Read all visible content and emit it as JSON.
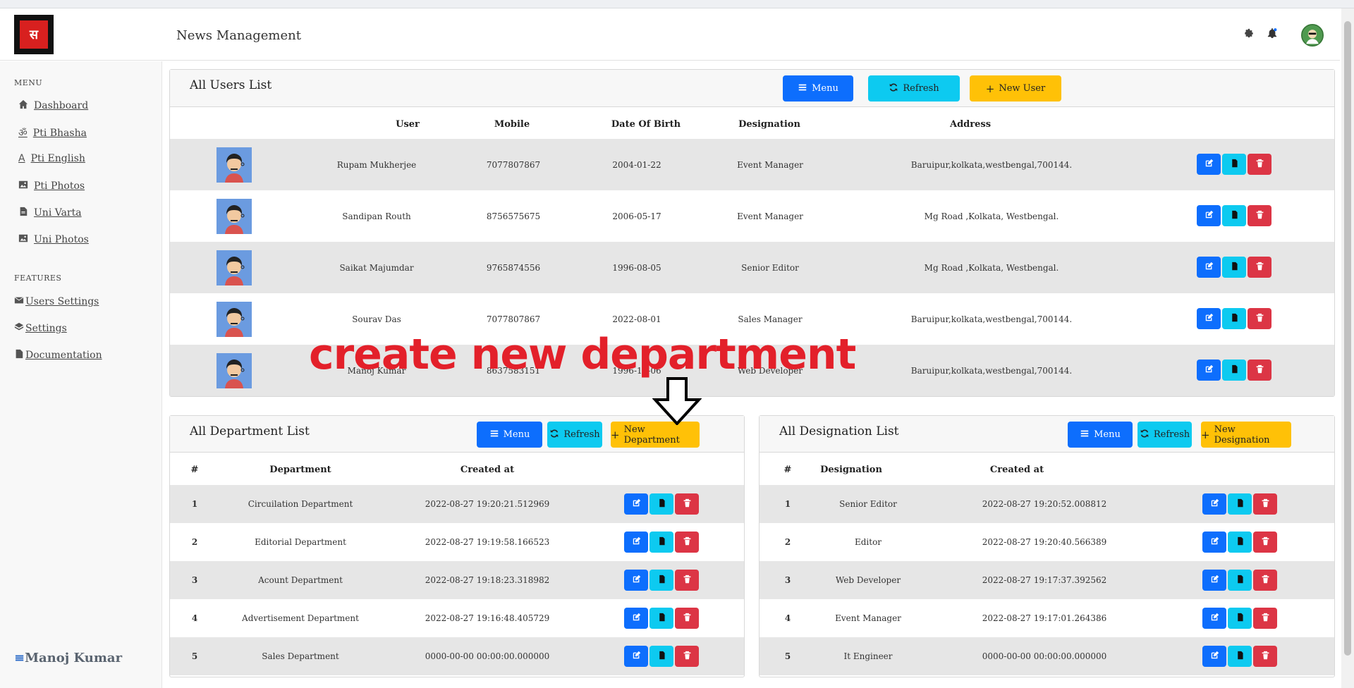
{
  "header": {
    "title": "News Management",
    "logo_text": "सन्मार्ग"
  },
  "sidebar": {
    "menu_label": "MENU",
    "menu_items": [
      {
        "label": "Dashboard",
        "icon": "home-icon"
      },
      {
        "label": "Pti Bhasha",
        "icon": "om-icon"
      },
      {
        "label": "Pti English",
        "icon": "letter-a-icon"
      },
      {
        "label": "Pti Photos",
        "icon": "image-icon"
      },
      {
        "label": "Uni Varta",
        "icon": "file-icon"
      },
      {
        "label": "Uni Photos",
        "icon": "image-icon"
      }
    ],
    "features_label": "FEATURES",
    "feature_items": [
      {
        "label": "Users Settings",
        "icon": "envelope-icon"
      },
      {
        "label": "Settings",
        "icon": "layers-icon"
      },
      {
        "label": "Documentation",
        "icon": "file-icon"
      }
    ],
    "user_name": "Manoj Kumar",
    "user_prefix": "≡"
  },
  "users": {
    "title": "All Users List",
    "buttons": {
      "menu": "Menu",
      "refresh": "Refresh",
      "new": "New User"
    },
    "columns": [
      "User",
      "Mobile",
      "Date Of Birth",
      "Designation",
      "Address"
    ],
    "rows": [
      {
        "name": "Rupam Mukherjee",
        "mobile": "7077807867",
        "dob": "2004-01-22",
        "designation": "Event Manager",
        "address": "Baruipur,kolkata,westbengal,700144."
      },
      {
        "name": "Sandipan Routh",
        "mobile": "8756575675",
        "dob": "2006-05-17",
        "designation": "Event Manager",
        "address": "Mg Road ,Kolkata, Westbengal."
      },
      {
        "name": "Saikat Majumdar",
        "mobile": "9765874556",
        "dob": "1996-08-05",
        "designation": "Senior Editor",
        "address": "Mg Road ,Kolkata, Westbengal."
      },
      {
        "name": "Sourav Das",
        "mobile": "7077807867",
        "dob": "2022-08-01",
        "designation": "Sales Manager",
        "address": "Baruipur,kolkata,westbengal,700144."
      },
      {
        "name": "Manoj Kumar",
        "mobile": "8637583151",
        "dob": "1996-12-06",
        "designation": "Web Developer",
        "address": "Baruipur,kolkata,westbengal,700144."
      }
    ]
  },
  "departments": {
    "title": "All Department List",
    "buttons": {
      "menu": "Menu",
      "refresh": "Refresh",
      "new": "New Department"
    },
    "columns": [
      "#",
      "Department",
      "Created at"
    ],
    "rows": [
      {
        "id": "1",
        "name": "Circuilation Department",
        "created": "2022-08-27 19:20:21.512969"
      },
      {
        "id": "2",
        "name": "Editorial Department",
        "created": "2022-08-27 19:19:58.166523"
      },
      {
        "id": "3",
        "name": "Acount Department",
        "created": "2022-08-27 19:18:23.318982"
      },
      {
        "id": "4",
        "name": "Advertisement Department",
        "created": "2022-08-27 19:16:48.405729"
      },
      {
        "id": "5",
        "name": "Sales Department",
        "created": "0000-00-00 00:00:00.000000"
      }
    ]
  },
  "designations": {
    "title": "All Designation List",
    "buttons": {
      "menu": "Menu",
      "refresh": "Refresh",
      "new": "New Designation"
    },
    "columns": [
      "#",
      "Designation",
      "Created at"
    ],
    "rows": [
      {
        "id": "1",
        "name": "Senior Editor",
        "created": "2022-08-27 19:20:52.008812"
      },
      {
        "id": "2",
        "name": "Editor",
        "created": "2022-08-27 19:20:40.566389"
      },
      {
        "id": "3",
        "name": "Web Developer",
        "created": "2022-08-27 19:17:37.392562"
      },
      {
        "id": "4",
        "name": "Event Manager",
        "created": "2022-08-27 19:17:01.264386"
      },
      {
        "id": "5",
        "name": "It Engineer",
        "created": "0000-00-00 00:00:00.000000"
      }
    ]
  },
  "annotation": {
    "text": "create new department",
    "color": "#e3202a"
  },
  "colors": {
    "primary": "#0d6efd",
    "info": "#0dcaf0",
    "warning": "#ffc107",
    "danger": "#dc3545"
  }
}
